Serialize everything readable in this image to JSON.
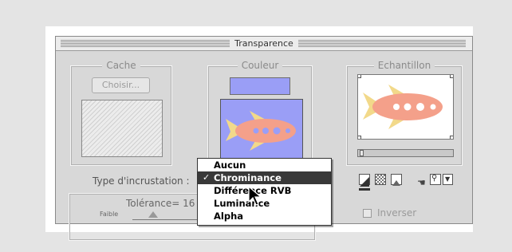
{
  "window": {
    "title": "Transparence"
  },
  "cache": {
    "legend": "Cache",
    "choose_label": "Choisir..."
  },
  "couleur": {
    "legend": "Couleur"
  },
  "echantillon": {
    "legend": "Echantillon"
  },
  "type_label": "Type d'incrustation :",
  "tolerance": {
    "label": "Tolérance= 16",
    "low_label": "Faible"
  },
  "inverser_label": "Inverser",
  "menu": {
    "items": [
      {
        "label": "Aucun",
        "checked": false,
        "selected": false
      },
      {
        "label": "Chrominance",
        "checked": true,
        "selected": true
      },
      {
        "label": "Différence RVB",
        "checked": false,
        "selected": false
      },
      {
        "label": "Luminance",
        "checked": false,
        "selected": false
      },
      {
        "label": "Alpha",
        "checked": false,
        "selected": false
      }
    ]
  },
  "colors": {
    "key_color": "#9a9ef6",
    "rocket_body": "#f4a08a",
    "rocket_fin": "#f2d98a",
    "background": "#e4e4e4"
  }
}
